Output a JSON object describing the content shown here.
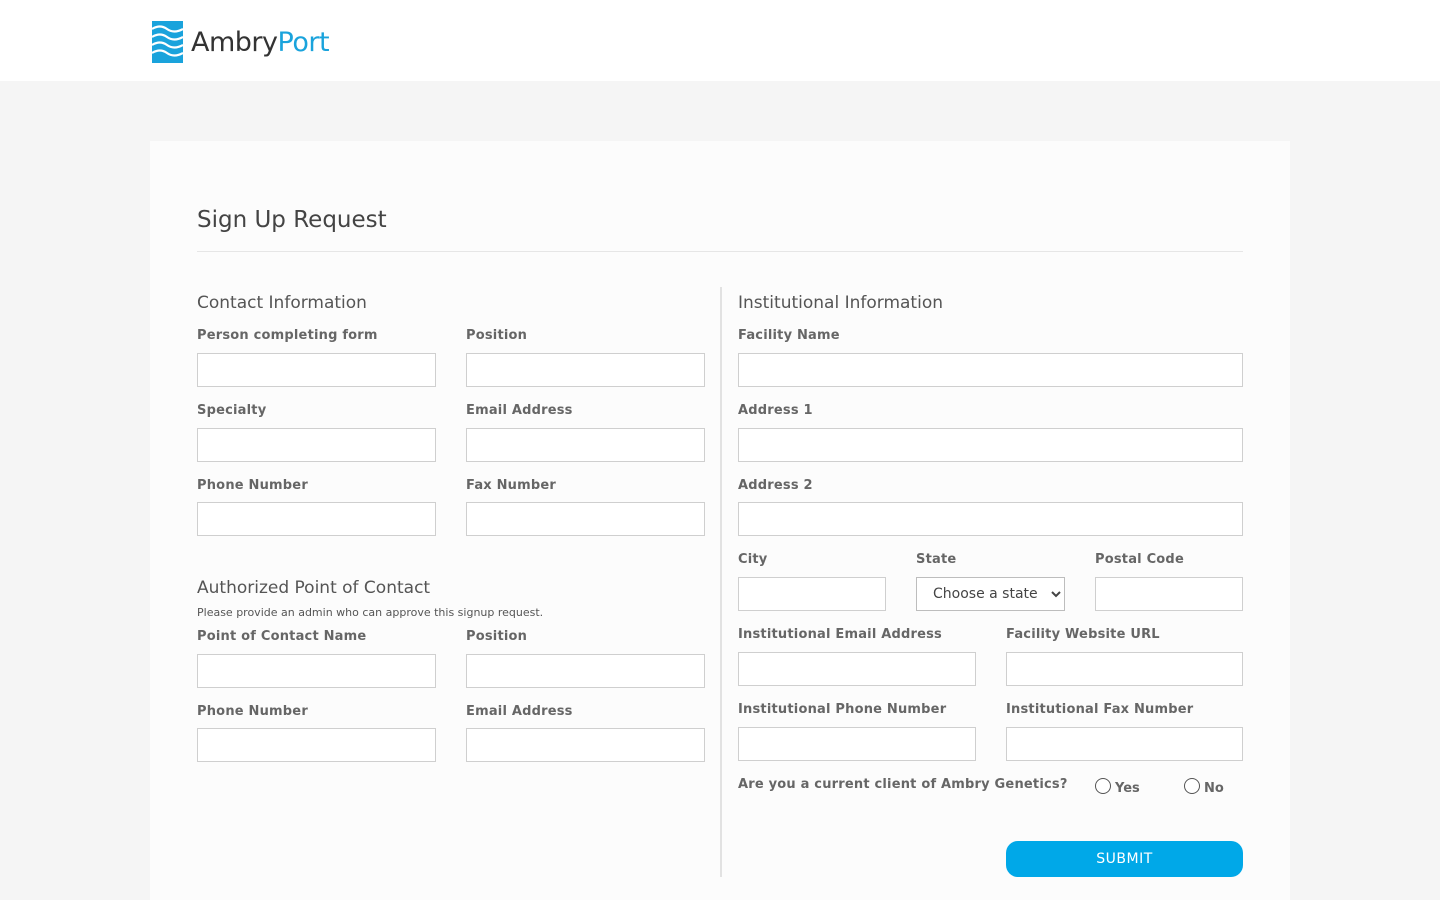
{
  "header": {
    "brand_part1": "Ambry",
    "brand_part2": "Port",
    "brand_color": "#1aa3dc"
  },
  "page": {
    "title": "Sign Up Request"
  },
  "contact": {
    "title": "Contact Information",
    "person_label": "Person completing form",
    "position_label": "Position",
    "specialty_label": "Specialty",
    "email_label": "Email Address",
    "phone_label": "Phone Number",
    "fax_label": "Fax Number"
  },
  "apoc": {
    "title": "Authorized Point of Contact",
    "note": "Please provide an admin who can approve this signup request.",
    "name_label": "Point of Contact Name",
    "position_label": "Position",
    "phone_label": "Phone Number",
    "email_label": "Email Address"
  },
  "institution": {
    "title": "Institutional Information",
    "facility_label": "Facility Name",
    "address1_label": "Address 1",
    "address2_label": "Address 2",
    "city_label": "City",
    "state_label": "State",
    "state_selected": "Choose a state",
    "postal_label": "Postal Code",
    "email_label": "Institutional Email Address",
    "website_label": "Facility Website URL",
    "phone_label": "Institutional Phone Number",
    "fax_label": "Institutional Fax Number",
    "client_question": "Are you a current client of Ambry Genetics?",
    "yes_label": "Yes",
    "no_label": "No"
  },
  "actions": {
    "submit_label": "SUBMIT",
    "submit_color": "#00a8e8"
  }
}
